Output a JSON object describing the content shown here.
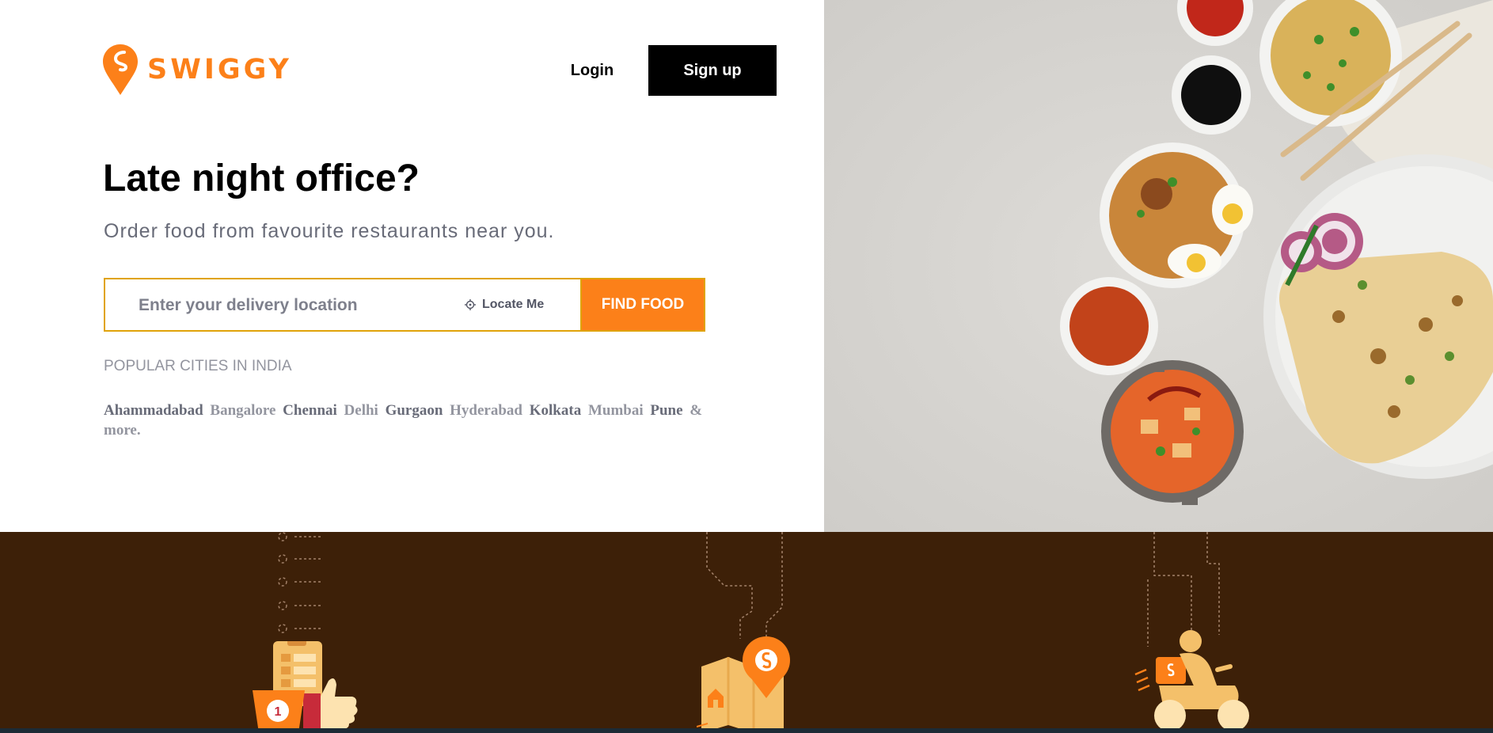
{
  "brand": {
    "name": "SWIGGY",
    "accent": "#fc8019"
  },
  "header": {
    "login_label": "Login",
    "signup_label": "Sign up"
  },
  "hero": {
    "headline": "Late night office?",
    "subline": "Order food from favourite restaurants near you."
  },
  "search": {
    "placeholder": "Enter your delivery location",
    "locate_label": "Locate Me",
    "submit_label": "FIND FOOD"
  },
  "cities": {
    "heading": "POPULAR CITIES IN INDIA",
    "items": [
      "Ahammadabad",
      "Bangalore",
      "Chennai",
      "Delhi",
      "Gurgaon",
      "Hyderabad",
      "Kolkata",
      "Mumbai",
      "Pune"
    ],
    "more_label": "& more."
  },
  "icons": {
    "logo": "swiggy-pin-logo-icon",
    "locate": "crosshair-icon",
    "order": "order-list-thumbs-up-icon",
    "map": "map-location-pin-icon",
    "delivery": "delivery-rider-scooter-icon"
  },
  "colors": {
    "footer_bg": "#3d2008",
    "search_border": "#e0a30a",
    "signup_bg": "#000000"
  }
}
